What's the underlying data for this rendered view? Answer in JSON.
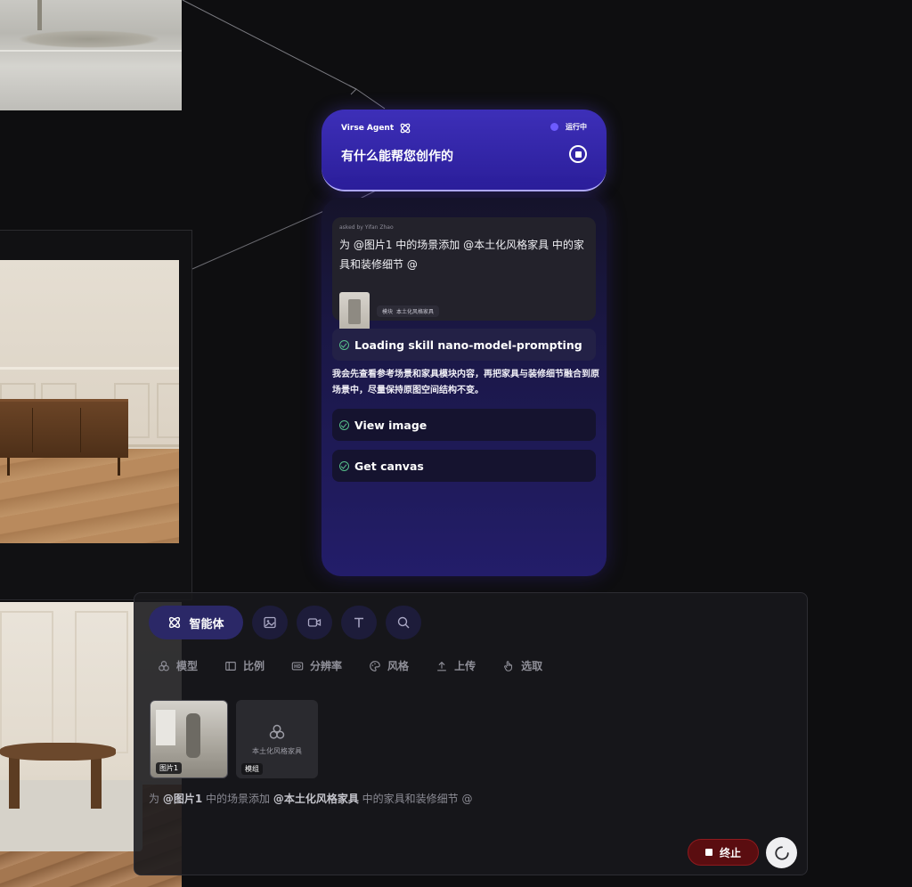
{
  "agent": {
    "brand": "Virse Agent",
    "status": "运行中",
    "title": "有什么能帮您创作的"
  },
  "chat": {
    "asked_by": "asked by Yifan Zhao",
    "message": "为 @图片1 中的场景添加 @本土化风格家具 中的家具和装修细节 @",
    "tag_prefix": "模块",
    "tag_name": "本土化风格家具",
    "steps": [
      {
        "label": "Loading skill nano-model-prompting"
      },
      {
        "label": "View image"
      },
      {
        "label": "Get canvas"
      }
    ],
    "description": "我会先查看参考场景和家具模块内容，再把家具与装修细节融合到原场景中，尽量保持原图空间结构不变。"
  },
  "prompt_panel": {
    "active_mode": "智能体",
    "options": [
      "模型",
      "比例",
      "分辨率",
      "风格",
      "上传",
      "选取"
    ],
    "attachments": [
      {
        "label": "图片1"
      },
      {
        "name": "本土化风格家具",
        "label": "模组"
      }
    ],
    "prompt_prefix": "为 ",
    "prompt_ref1": "@图片1",
    "prompt_mid": " 中的场景添加 ",
    "prompt_ref2": "@本土化风格家具",
    "prompt_suffix": " 中的家具和装修细节 @",
    "stop_label": "终止"
  },
  "colors": {
    "accent": "#3d2fb8",
    "success": "#57c08b",
    "danger": "#5a0d10"
  }
}
